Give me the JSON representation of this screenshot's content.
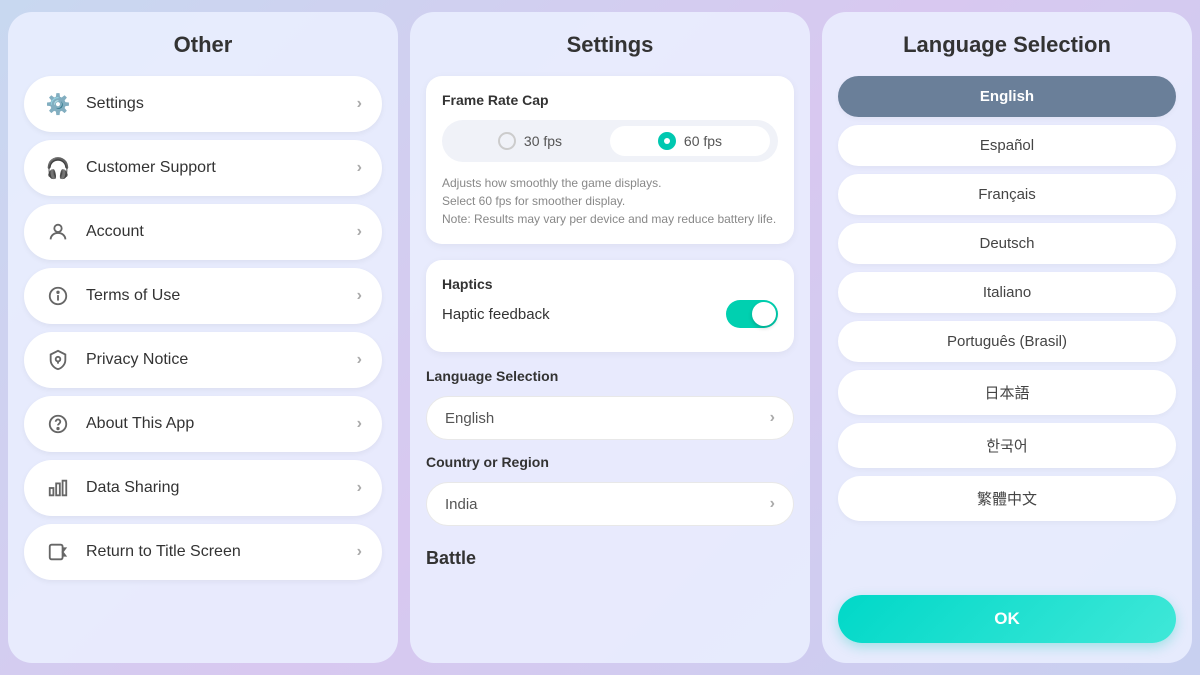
{
  "left": {
    "title": "Other",
    "items": [
      {
        "id": "settings",
        "label": "Settings",
        "icon": "⚙️"
      },
      {
        "id": "customer-support",
        "label": "Customer Support",
        "icon": "🎧"
      },
      {
        "id": "account",
        "label": "Account",
        "icon": "👤"
      },
      {
        "id": "terms-of-use",
        "label": "Terms of Use",
        "icon": "ℹ️"
      },
      {
        "id": "privacy-notice",
        "label": "Privacy Notice",
        "icon": "🛡️"
      },
      {
        "id": "about-app",
        "label": "About This App",
        "icon": "❓"
      },
      {
        "id": "data-sharing",
        "label": "Data Sharing",
        "icon": "📊"
      },
      {
        "id": "return-title",
        "label": "Return to Title Screen",
        "icon": "↩️"
      }
    ]
  },
  "middle": {
    "title": "Settings",
    "frame_rate": {
      "label": "Frame Rate Cap",
      "option_30": "30 fps",
      "option_60": "60 fps",
      "selected": "60",
      "description": "Adjusts how smoothly the game displays.\nSelect 60 fps for smoother display.\nNote: Results may vary per device and may reduce battery life."
    },
    "haptics": {
      "section_label": "Haptics",
      "label": "Haptic feedback",
      "enabled": true
    },
    "language": {
      "section_label": "Language Selection",
      "selected": "English",
      "chevron": "›"
    },
    "country": {
      "section_label": "Country or Region",
      "selected": "India",
      "chevron": "›"
    },
    "battle_label": "Battle"
  },
  "right": {
    "title": "Language Selection",
    "languages": [
      {
        "code": "en",
        "label": "English",
        "selected": true
      },
      {
        "code": "es",
        "label": "Español",
        "selected": false
      },
      {
        "code": "fr",
        "label": "Français",
        "selected": false
      },
      {
        "code": "de",
        "label": "Deutsch",
        "selected": false
      },
      {
        "code": "it",
        "label": "Italiano",
        "selected": false
      },
      {
        "code": "pt",
        "label": "Português (Brasil)",
        "selected": false
      },
      {
        "code": "ja",
        "label": "日本語",
        "selected": false
      },
      {
        "code": "ko",
        "label": "한국어",
        "selected": false
      },
      {
        "code": "zh",
        "label": "繁體中文",
        "selected": false
      }
    ],
    "ok_label": "OK"
  }
}
